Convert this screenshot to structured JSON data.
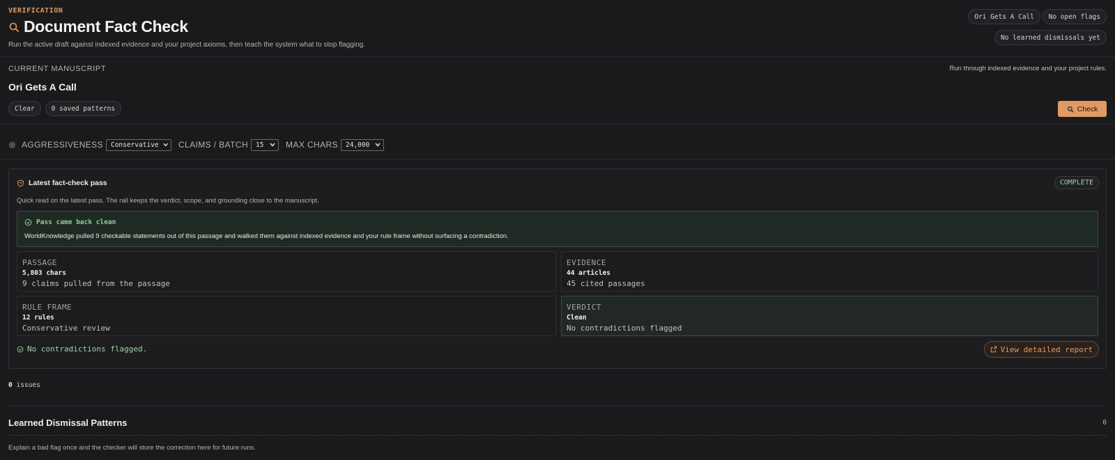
{
  "header": {
    "eyebrow": "VERIFICATION",
    "title": "Document Fact Check",
    "subtitle": "Run the active draft against indexed evidence and your project axioms, then teach the system what to stop flagging.",
    "badges": [
      "Ori Gets A Call",
      "No open flags",
      "No learned dismissals yet"
    ]
  },
  "manuscript": {
    "label": "CURRENT MANUSCRIPT",
    "hint": "Run through indexed evidence and your project rules.",
    "title": "Ori Gets A Call",
    "clear_label": "Clear",
    "patterns_label": "0 saved patterns",
    "check_label": "Check"
  },
  "controls": {
    "aggressiveness_label": "AGGRESSIVENESS",
    "aggressiveness_value": "Conservative",
    "claims_label": "CLAIMS / BATCH",
    "claims_value": "15",
    "maxchars_label": "MAX CHARS",
    "maxchars_value": "24,000"
  },
  "pass": {
    "title": "Latest fact-check pass",
    "status": "COMPLETE",
    "description": "Quick read on the latest pass. The rail keeps the verdict, scope, and grounding close to the manuscript.",
    "clean_title": "Pass came back clean",
    "clean_text": "WorldKnowledge pulled 9 checkable statements out of this passage and walked them against indexed evidence and your rule frame without surfacing a contradiction.",
    "stats": {
      "passage": {
        "label": "PASSAGE",
        "value": "5,803 chars",
        "detail": "9 claims pulled from the passage"
      },
      "evidence": {
        "label": "EVIDENCE",
        "value": "44 articles",
        "detail": "45 cited passages"
      },
      "rule_frame": {
        "label": "RULE FRAME",
        "value": "12 rules",
        "detail": "Conservative review"
      },
      "verdict": {
        "label": "VERDICT",
        "value": "Clean",
        "detail": "No contradictions flagged"
      }
    },
    "footer_status": "No contradictions flagged.",
    "report_label": "View detailed report"
  },
  "issues": {
    "count": "0",
    "label": "issues"
  },
  "dismissals": {
    "title": "Learned Dismissal Patterns",
    "count": "0",
    "description": "Explain a bad flag once and the checker will store the correction here for future runs."
  },
  "colors": {
    "accent": "#e29a64",
    "success": "#8fcf9a",
    "background": "#1a1a1d"
  }
}
